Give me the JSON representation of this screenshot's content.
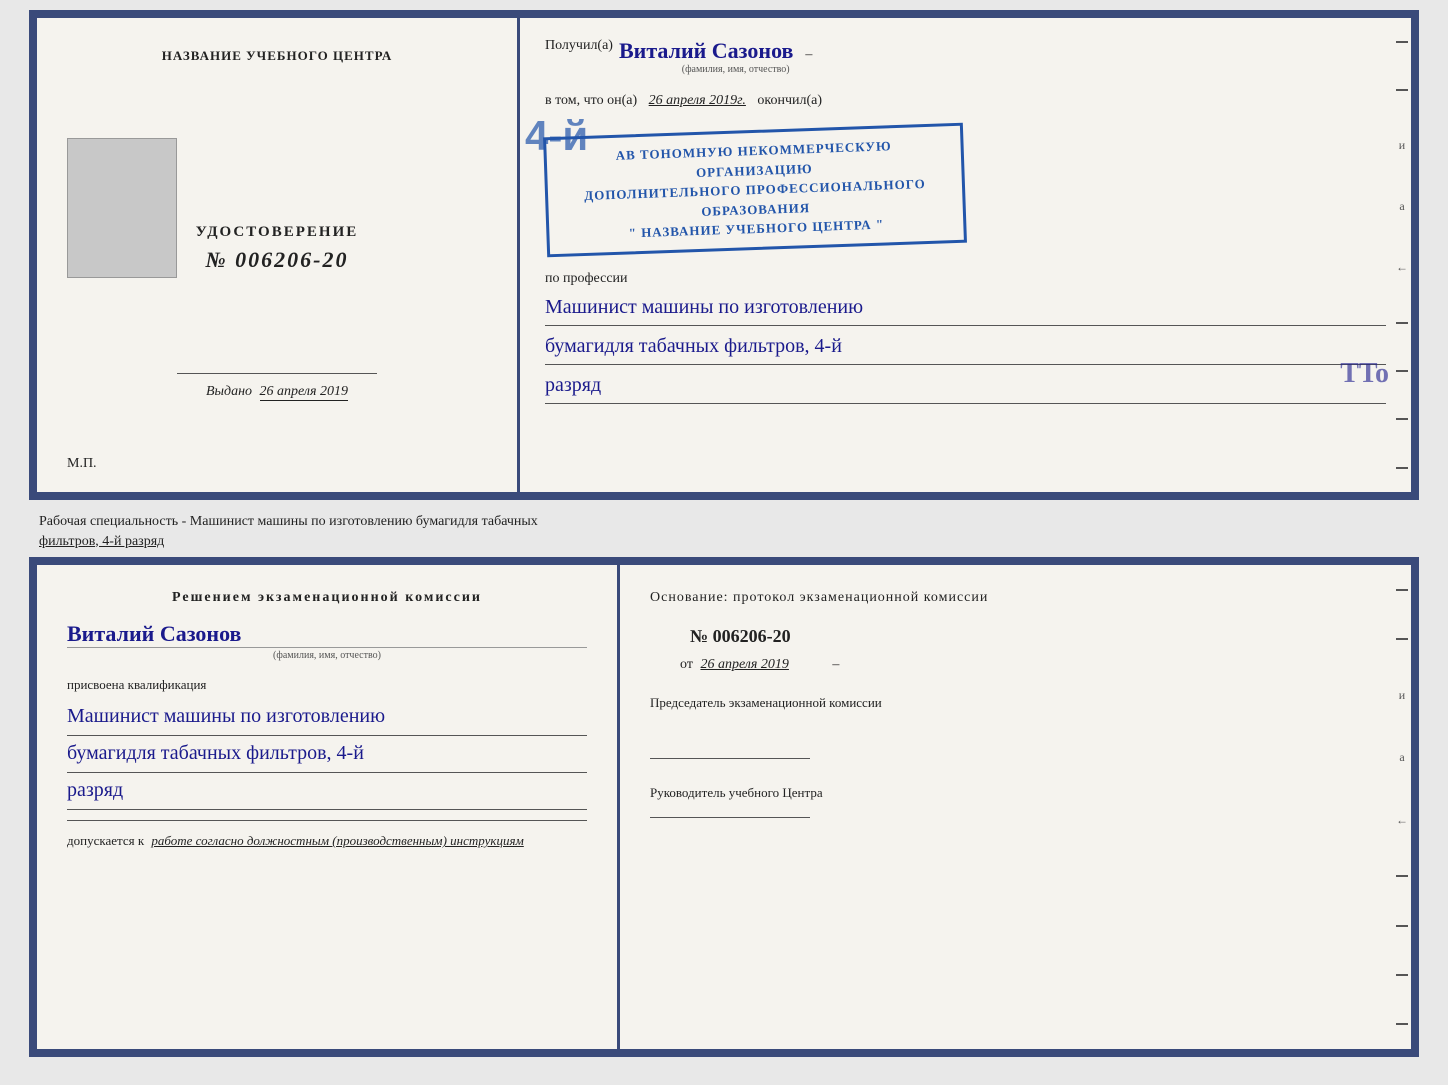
{
  "top_doc": {
    "left": {
      "title": "НАЗВАНИЕ УЧЕБНОГО ЦЕНТРА",
      "cert_label": "УДОСТОВЕРЕНИЕ",
      "cert_number": "№ 006206-20",
      "issued_label": "Выдано",
      "issued_date": "26 апреля 2019",
      "mp_label": "М.П."
    },
    "right": {
      "received_prefix": "Получил(а)",
      "received_name": "Виталий Сазонов",
      "received_name_hint": "(фамилия, имя, отчество)",
      "dash": "–",
      "date_prefix": "в том, что он(а)",
      "date_value": "26 апреля 2019г.",
      "date_suffix": "окончил(а)",
      "stamp_line1": "АВ ТОНОМНУЮ НЕКОММЕРЧЕСКУЮ ОРГАНИЗАЦИЮ",
      "stamp_line2": "ДОПОЛНИТЕЛЬНОГО ПРОФЕССИОНАЛЬНОГО ОБРАЗОВАНИЯ",
      "stamp_line3": "\" НАЗВАНИЕ УЧЕБНОГО ЦЕНТРА \"",
      "stamp_number": "4-й",
      "profession_label": "по профессии",
      "profession_line1": "Машинист машины по изготовлению",
      "profession_line2": "бумагидля табачных фильтров, 4-й",
      "profession_line3": "разряд"
    }
  },
  "description": {
    "text_part1": "Рабочая специальность - Машинист машины по изготовлению бумагидля табачных",
    "text_part2": "фильтров, 4-й разряд"
  },
  "bottom_doc": {
    "left": {
      "commission_title": "Решением  экзаменационной  комиссии",
      "name_handwritten": "Виталий Сазонов",
      "name_hint": "(фамилия, имя, отчество)",
      "assigned_label": "присвоена квалификация",
      "qual_line1": "Машинист машины по изготовлению",
      "qual_line2": "бумагидля табачных фильтров, 4-й",
      "qual_line3": "разряд",
      "allowed_label": "допускается к",
      "allowed_italic": "работе согласно должностным (производственным) инструкциям"
    },
    "right": {
      "basis_label": "Основание: протокол экзаменационной  комиссии",
      "protocol_number": "№  006206-20",
      "from_label": "от",
      "from_date": "26 апреля 2019",
      "chairman_label": "Председатель экзаменационной комиссии",
      "director_label": "Руководитель учебного Центра"
    }
  },
  "side_chars": [
    "–",
    "–",
    "и",
    "а",
    "←",
    "–",
    "–",
    "–",
    "–"
  ],
  "tto": "TTo"
}
